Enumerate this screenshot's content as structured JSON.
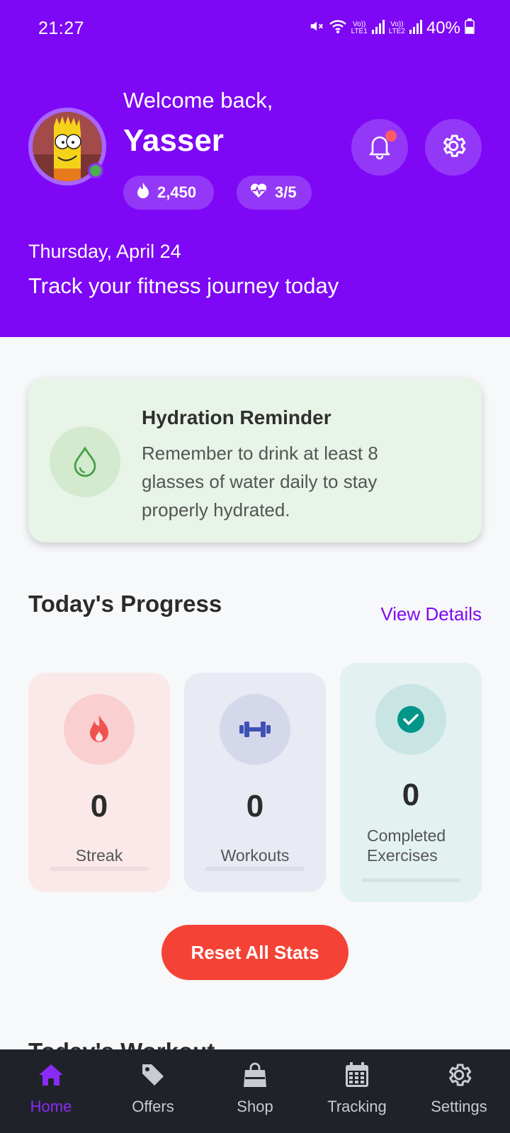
{
  "status_bar": {
    "time": "21:27",
    "network_1": "LTE1",
    "network_2": "LTE2",
    "battery": "40%"
  },
  "header": {
    "welcome": "Welcome back,",
    "username": "Yasser",
    "points": "2,450",
    "lives": "3/5",
    "date": "Thursday, April 24",
    "tagline": "Track your fitness journey today"
  },
  "hydration": {
    "title": "Hydration Reminder",
    "text": "Remember to drink at least 8 glasses of water daily to stay properly hydrated."
  },
  "progress": {
    "title": "Today's Progress",
    "view_details": "View Details",
    "stats": [
      {
        "value": "0",
        "label": "Streak"
      },
      {
        "value": "0",
        "label": "Workouts"
      },
      {
        "value": "0",
        "label": "Completed Exercises"
      }
    ],
    "reset_label": "Reset All Stats"
  },
  "peek": {
    "title": "Today's Workout"
  },
  "nav": {
    "items": [
      {
        "label": "Home",
        "icon": "home-icon"
      },
      {
        "label": "Offers",
        "icon": "tag-icon"
      },
      {
        "label": "Shop",
        "icon": "shopping-bag-icon"
      },
      {
        "label": "Tracking",
        "icon": "calendar-icon"
      },
      {
        "label": "Settings",
        "icon": "gear-icon"
      }
    ]
  },
  "colors": {
    "primary": "#7e08f5",
    "danger": "#f44336",
    "nav_bg": "#20222a",
    "hydration_bg": "#e8f4e8"
  }
}
